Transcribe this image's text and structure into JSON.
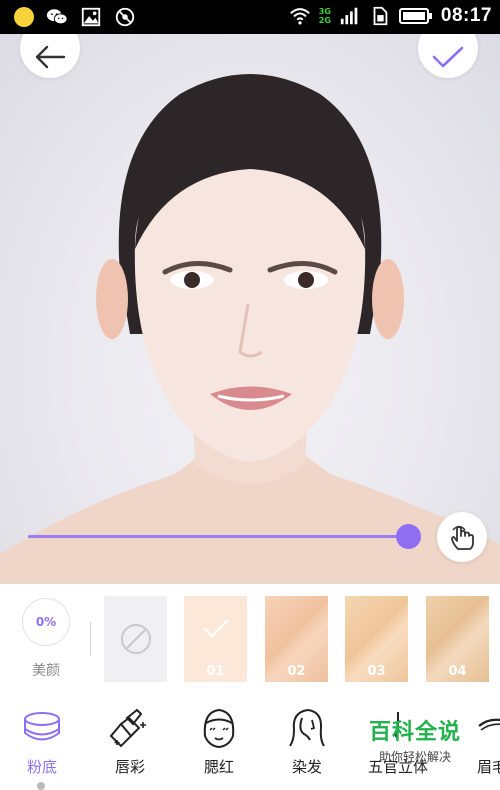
{
  "status_bar": {
    "time": "08:17",
    "network_top": "3G",
    "network_bottom": "2G",
    "icons": [
      "notification-dot-icon",
      "wechat-icon",
      "image-icon",
      "blocked-icon",
      "wifi-icon",
      "signal-icon",
      "sim-icon",
      "battery-icon"
    ]
  },
  "photo": {
    "subject": "portrait",
    "slider": {
      "value": 1.0
    }
  },
  "beauty": {
    "percent": "0%",
    "label": "美颜"
  },
  "swatches": [
    {
      "id": "none",
      "label": "",
      "selected": false
    },
    {
      "id": "01",
      "label": "01",
      "selected": true,
      "color": "#fbe8d8"
    },
    {
      "id": "02",
      "label": "02",
      "selected": false,
      "color": "#f0c29f"
    },
    {
      "id": "03",
      "label": "03",
      "selected": false,
      "color": "#efc598"
    },
    {
      "id": "04",
      "label": "04",
      "selected": false,
      "color": "#e6c093"
    }
  ],
  "tabs": [
    {
      "id": "foundation",
      "label": "粉底",
      "icon": "compact-icon",
      "active": true
    },
    {
      "id": "lip",
      "label": "唇彩",
      "icon": "lipstick-icon",
      "active": false
    },
    {
      "id": "blush",
      "label": "腮红",
      "icon": "blush-face-icon",
      "active": false
    },
    {
      "id": "hair",
      "label": "染发",
      "icon": "hair-icon",
      "active": false
    },
    {
      "id": "contour",
      "label": "五官立体",
      "icon": "contour-icon",
      "active": false
    },
    {
      "id": "brow",
      "label": "眉毛",
      "icon": "eyebrow-icon",
      "active": false
    }
  ],
  "watermark": {
    "title": "百科全说",
    "subtitle": "助你轻松解决"
  },
  "colors": {
    "accent": "#8e6ff4",
    "watermark": "#22b14c"
  }
}
